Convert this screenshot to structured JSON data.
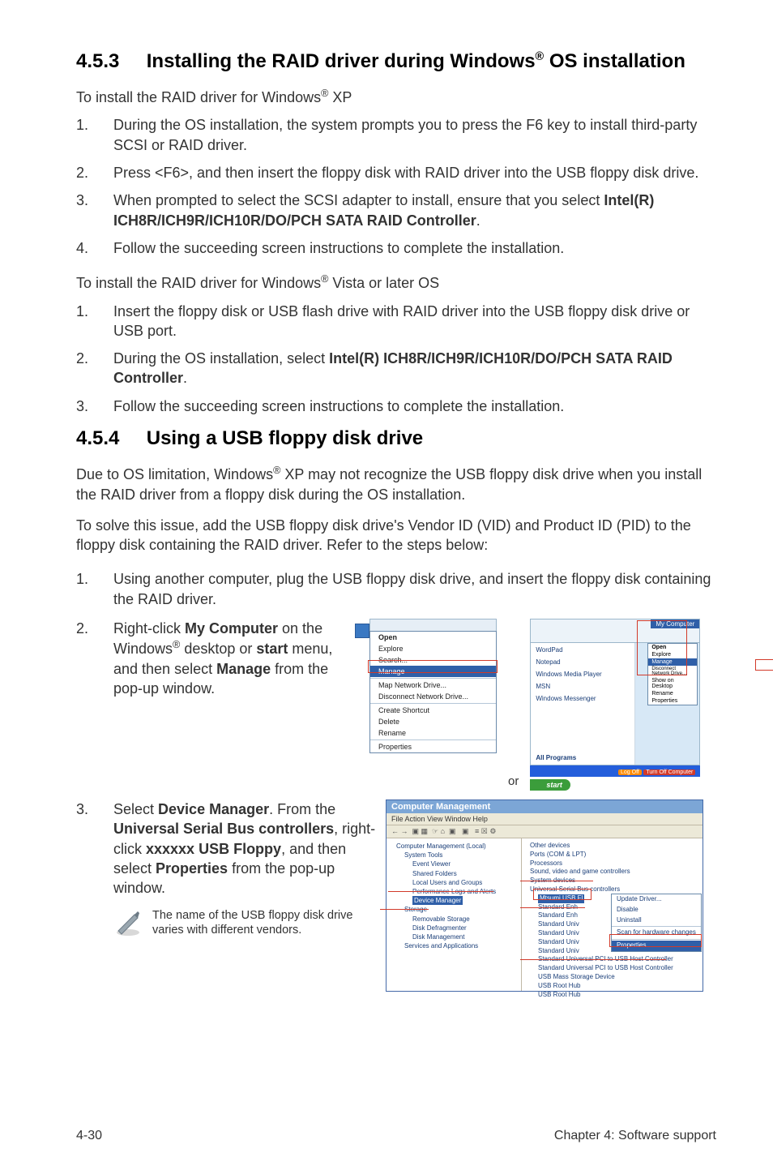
{
  "section1": {
    "heading_num": "4.5.3",
    "heading_text_pre": "Installing the RAID driver during Windows",
    "heading_sup": "®",
    "heading_text_post": " OS installation",
    "para1_pre": "To install the RAID driver for Windows",
    "para1_sup": "®",
    "para1_post": " XP",
    "list1": [
      {
        "n": "1.",
        "t": "During the OS installation, the system prompts you to press the F6 key to install third-party SCSI or RAID driver."
      },
      {
        "n": "2.",
        "t": "Press <F6>, and then insert the floppy disk with RAID driver into the USB floppy disk drive."
      },
      {
        "n": "3.",
        "t_pre": "When prompted to select the SCSI adapter to install, ensure that you select ",
        "t_bold": "Intel(R) ICH8R/ICH9R/ICH10R/DO/PCH SATA RAID Controller",
        "t_post": "."
      },
      {
        "n": "4.",
        "t": "Follow the succeeding screen instructions to complete the installation."
      }
    ],
    "para2_pre": "To install the RAID driver for Windows",
    "para2_sup": "®",
    "para2_post": " Vista or later OS",
    "list2": [
      {
        "n": "1.",
        "t": "Insert the floppy disk or USB flash drive with RAID driver into the USB floppy disk drive or USB port."
      },
      {
        "n": "2.",
        "t_pre": "During the OS installation, select ",
        "t_bold": "Intel(R) ICH8R/ICH9R/ICH10R/DO/PCH SATA RAID Controller",
        "t_post": "."
      },
      {
        "n": "3.",
        "t": "Follow the succeeding screen instructions to complete the installation."
      }
    ]
  },
  "section2": {
    "heading_num": "4.5.4",
    "heading_text": "Using a USB floppy disk drive",
    "para1_pre": "Due to OS limitation, Windows",
    "para1_sup": "®",
    "para1_post": " XP may not recognize the USB floppy disk drive when you install the RAID driver from a floppy disk during the OS installation.",
    "para2": "To solve this issue, add the USB floppy disk drive's Vendor ID (VID) and Product ID (PID) to the floppy disk containing the RAID driver. Refer to the steps below:",
    "list": [
      {
        "n": "1.",
        "t": "Using another computer, plug the USB floppy disk drive, and insert the floppy disk containing the RAID driver."
      },
      {
        "n": "2.",
        "t_pre": "Right-click ",
        "t_b1": "My Computer",
        "t_mid1": " on the Windows",
        "t_sup": "®",
        "t_mid2": " desktop or ",
        "t_b2": "start",
        "t_mid3": " menu, and then select ",
        "t_b3": "Manage",
        "t_post": " from the pop-up window."
      },
      {
        "n": "3.",
        "t_pre": "Select ",
        "t_b1": "Device Manager",
        "t_mid1": ". From the ",
        "t_b2": "Universal Serial Bus controllers",
        "t_mid2": ", right-click ",
        "t_b3": "xxxxxx USB Floppy",
        "t_mid3": ", and then select ",
        "t_b4": "Properties",
        "t_post": " from the pop-up window."
      }
    ],
    "note": "The name of the USB floppy disk drive varies with different vendors."
  },
  "illus1": {
    "ctx_items": [
      "Open",
      "Explore",
      "Search...",
      "Manage",
      "Map Network Drive...",
      "Disconnect Network Drive...",
      "Create Shortcut",
      "Delete",
      "Rename",
      "Properties"
    ],
    "or": "or",
    "start_left": [
      "WordPad",
      "Notepad",
      "Windows Media Player",
      "MSN",
      "Windows Messenger"
    ],
    "all_programs": "All Programs",
    "mc_title": "My Computer",
    "mc_ctx": [
      "Open",
      "Explore",
      "Manage",
      "Disconnect Network Drive...",
      "Show on Desktop",
      "Rename",
      "Properties"
    ],
    "logoff": "Log Off",
    "turnoff": "Turn Off Computer",
    "start_btn": "start"
  },
  "illus2": {
    "title": "Computer Management",
    "menubar": "File   Action   View   Window   Help",
    "left_tree": [
      "Computer Management (Local)",
      "System Tools",
      "Event Viewer",
      "Shared Folders",
      "Local Users and Groups",
      "Performance Logs and Alerts",
      "Device Manager",
      "Storage",
      "Removable Storage",
      "Disk Defragmenter",
      "Disk Management",
      "Services and Applications"
    ],
    "right_tree_top": [
      "Other devices",
      "Ports (COM & LPT)",
      "Processors",
      "Sound, video and game controllers",
      "System devices",
      "Universal Serial Bus controllers"
    ],
    "selected": "Mtsumi USB Fl",
    "right_items": [
      "Standard Enh",
      "Standard Enh",
      "Standard Univ",
      "Standard Univ",
      "Standard Univ",
      "Standard Univ",
      "Standard Universal PCI to USB Host Controller",
      "Standard Universal PCI to USB Host Controller",
      "USB Mass Storage Device",
      "USB Root Hub",
      "USB Root Hub"
    ],
    "ctx": [
      "Update Driver...",
      "Disable",
      "Uninstall",
      "Scan for hardware changes",
      "Properties"
    ]
  },
  "footer": {
    "left": "4-30",
    "right": "Chapter 4: Software support"
  }
}
